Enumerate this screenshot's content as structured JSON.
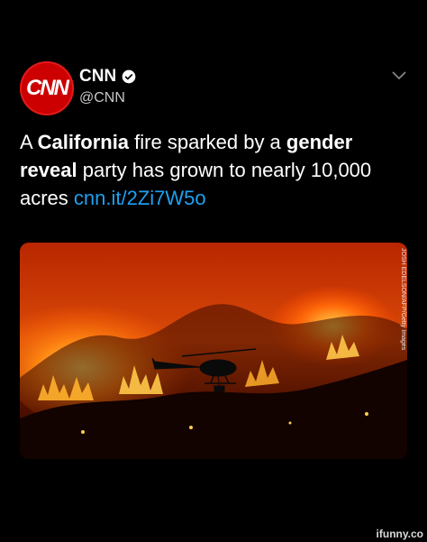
{
  "tweet": {
    "display_name": "CNN",
    "handle": "@CNN",
    "avatar_text": "CNN",
    "text_segments": [
      {
        "t": "A ",
        "bold": false
      },
      {
        "t": "California",
        "bold": true
      },
      {
        "t": " fire sparked by a ",
        "bold": false
      },
      {
        "t": "gender reveal",
        "bold": true
      },
      {
        "t": " party has grown to nearly 10,000 acres ",
        "bold": false
      }
    ],
    "link": "cnn.it/2Zi7W5o"
  },
  "media": {
    "credit": "JOSH EDELSON/AFP/Getty Images"
  },
  "watermark": "ifunny.co",
  "colors": {
    "background": "#000000",
    "brand_red": "#cc0000",
    "link_blue": "#1da1f2"
  },
  "icons": [
    "verified-icon",
    "chevron-down-icon"
  ]
}
